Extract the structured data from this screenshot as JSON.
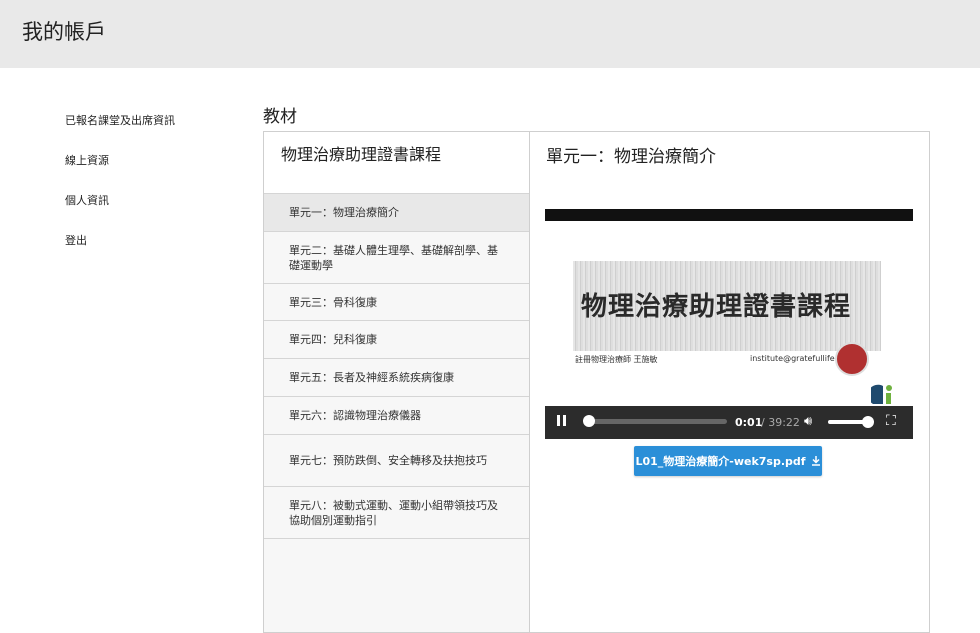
{
  "header": {
    "title": "我的帳戶"
  },
  "sidebar": {
    "items": [
      {
        "label": "已報名課堂及出席資訊"
      },
      {
        "label": "線上資源"
      },
      {
        "label": "個人資訊"
      },
      {
        "label": "登出"
      }
    ]
  },
  "main": {
    "section_title": "教材",
    "course": {
      "title": "物理治療助理證書課程",
      "units": [
        {
          "label": "單元一：物理治療簡介",
          "active": true
        },
        {
          "label": "單元二：基礎人體生理學、基礎解剖學、基礎運動學"
        },
        {
          "label": "單元三：骨科復康"
        },
        {
          "label": "單元四：兒科復康"
        },
        {
          "label": "單元五：長者及神經系統疾病復康"
        },
        {
          "label": "單元六：認識物理治療儀器"
        },
        {
          "label": "單元七：預防跌倒、安全轉移及扶抱技巧"
        },
        {
          "label": "單元八：被動式運動、運動小組帶領技巧及協助個別運動指引"
        }
      ]
    },
    "current_unit": {
      "title": "單元一：物理治療簡介",
      "video": {
        "slide_title": "物理治療助理證書課程",
        "slide_left_caption": "註冊物理治療師 王施敏",
        "slide_right_caption": "institute@gratefullife.com.hk",
        "current_time": "0:01",
        "total_time": "/ 39:22",
        "progress": 0.0004,
        "volume": 1.0
      },
      "download": {
        "label": "L01_物理治療簡介-wek7sp.pdf",
        "icon": "download-icon"
      }
    }
  },
  "colors": {
    "accent": "#2b8fd8",
    "header_bg": "#e9e9e9"
  }
}
